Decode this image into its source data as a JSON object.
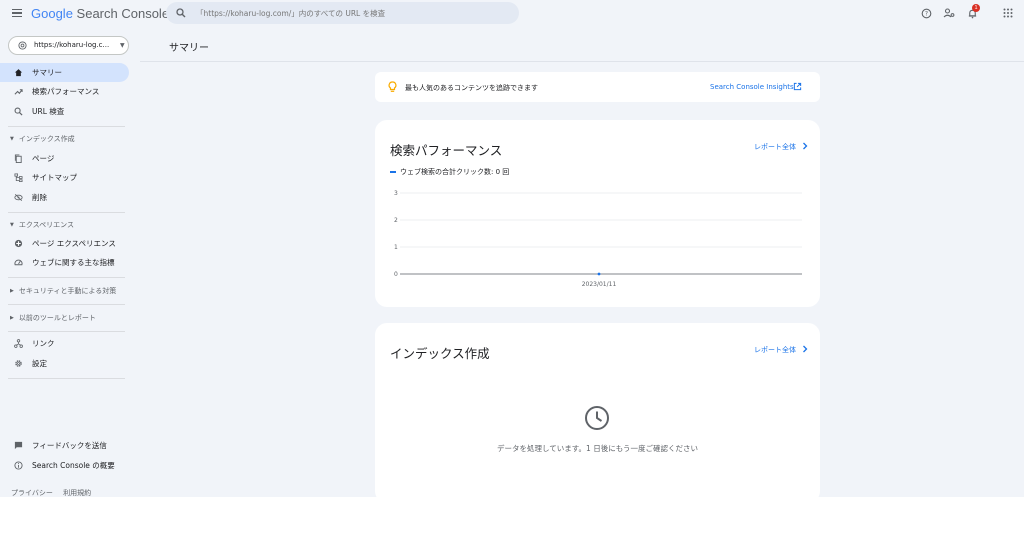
{
  "topbar": {
    "logo_google": "Google",
    "logo_product": "Search Console",
    "search_placeholder": "「https://koharu-log.com/」内のすべての URL を検査",
    "notification_count": "1",
    "icons": [
      "menu-icon",
      "search-icon",
      "help-icon",
      "account-settings-icon",
      "notifications-icon",
      "apps-grid-icon"
    ]
  },
  "sidebar": {
    "property": "https://koharu-log.c...",
    "items_top": [
      {
        "label": "サマリー",
        "icon": "home-icon"
      },
      {
        "label": "検索パフォーマンス",
        "icon": "trending-up-icon"
      },
      {
        "label": "URL 検査",
        "icon": "search-icon"
      }
    ],
    "index_section": "インデックス作成",
    "index_items": [
      {
        "label": "ページ",
        "icon": "pages-icon"
      },
      {
        "label": "サイトマップ",
        "icon": "sitemap-icon"
      },
      {
        "label": "削除",
        "icon": "removals-icon"
      }
    ],
    "experience_section": "エクスペリエンス",
    "experience_items": [
      {
        "label": "ページ エクスペリエンス",
        "icon": "page-experience-icon"
      },
      {
        "label": "ウェブに関する主な指標",
        "icon": "speed-gauge-icon"
      }
    ],
    "security_section": "セキュリティと手動による対策",
    "legacy_section": "以前のツールとレポート",
    "items_bottom": [
      {
        "label": "リンク",
        "icon": "links-icon"
      },
      {
        "label": "設定",
        "icon": "settings-gear-icon"
      }
    ],
    "footer_items": [
      {
        "label": "フィードバックを送信",
        "icon": "feedback-icon"
      },
      {
        "label": "Search Console の概要",
        "icon": "info-icon"
      }
    ],
    "privacy": "プライバシー",
    "terms": "利用規約"
  },
  "main": {
    "page_title": "サマリー",
    "insight": {
      "text": "最も人気のあるコンテンツを追跡できます",
      "link": "Search Console Insights"
    },
    "performance": {
      "title": "検索パフォーマンス",
      "report_link": "レポート全体",
      "legend": "ウェブ検索の合計クリック数: 0 回"
    },
    "index": {
      "title": "インデックス作成",
      "report_link": "レポート全体",
      "message": "データを処理しています。1 日後にもう一度ご確認ください"
    }
  },
  "colors": {
    "accent": "#1a73e8",
    "active_nav": "#d3e3fd",
    "background": "#f1f4f9",
    "badge": "#d93025",
    "bulb": "#f9ab00"
  },
  "chart_data": {
    "type": "line",
    "x": [
      "2023/01/11"
    ],
    "series": [
      {
        "name": "ウェブ検索の合計クリック数",
        "values": [
          0
        ]
      }
    ],
    "yticks": [
      0,
      1,
      2,
      3
    ],
    "ylim": [
      0,
      3
    ],
    "xlabel": "",
    "ylabel": "",
    "grid": true
  }
}
